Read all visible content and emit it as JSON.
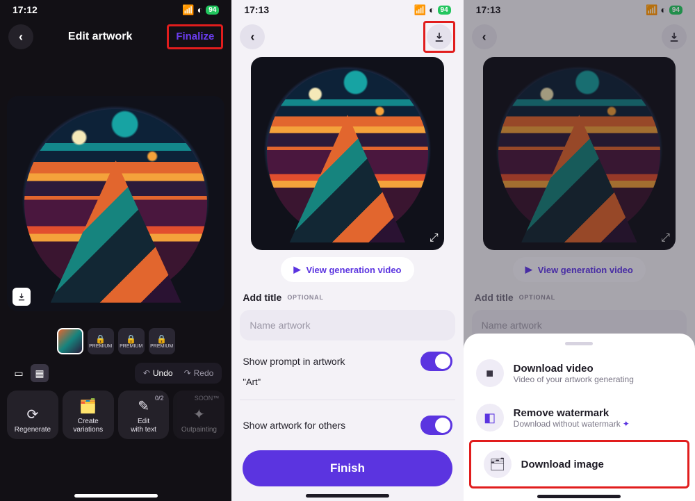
{
  "status": {
    "time": "17:12",
    "time2": "17:13",
    "battery": "94"
  },
  "pane1": {
    "title": "Edit artwork",
    "finalize": "Finalize",
    "thumb_premium": "PREMIUM",
    "undo": "Undo",
    "redo": "Redo",
    "actions": {
      "regenerate": "Regenerate",
      "variations": "Create\nvariations",
      "edit": "Edit\nwith text",
      "edit_badge": "0/2",
      "outpainting": "Outpainting",
      "soon": "SOON™"
    }
  },
  "pane2": {
    "view_gen": "View generation video",
    "add_title": "Add title",
    "optional": "OPTIONAL",
    "placeholder": "Name artwork",
    "show_prompt": "Show prompt in artwork",
    "prompt_value": "\"Art\"",
    "show_others": "Show artwork for others",
    "finish": "Finish"
  },
  "pane3": {
    "view_gen": "View generation video",
    "add_title": "Add title",
    "optional": "OPTIONAL",
    "placeholder": "Name artwork",
    "sheet": {
      "dl_video_t": "Download video",
      "dl_video_s": "Video of your artwork generating",
      "remove_t": "Remove watermark",
      "remove_s": "Download without watermark",
      "dl_image_t": "Download image"
    }
  }
}
